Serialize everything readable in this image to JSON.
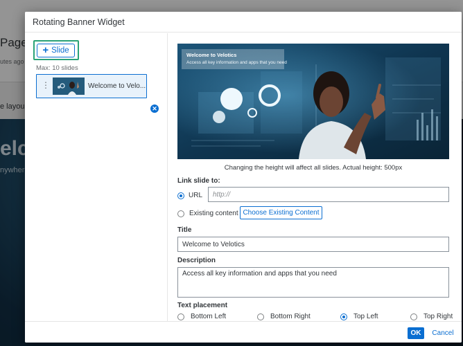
{
  "background": {
    "page_title": "Page",
    "time_fragment": "utes ago",
    "layout_fragment": "e layou",
    "welcome_fragment": "elco",
    "anywhere_fragment": "nywher"
  },
  "dialog": {
    "title": "Rotating Banner Widget",
    "add_slide_label": "Slide",
    "max_slides": "Max: 10 slides",
    "slides": [
      {
        "label": "Welcome to Velo..."
      }
    ],
    "preview": {
      "title": "Welcome to Velotics",
      "subtitle": "Access all key information and apps that you need"
    },
    "height_note": "Changing the height will affect all slides. Actual height: 500px",
    "link": {
      "label": "Link slide to:",
      "url_option": "URL",
      "url_placeholder": "http://",
      "url_value": "",
      "existing_option": "Existing content",
      "choose_button": "Choose Existing Content",
      "selected": "url"
    },
    "title_field": {
      "label": "Title",
      "value": "Welcome to Velotics"
    },
    "description_field": {
      "label": "Description",
      "value": "Access all key information and apps that you need"
    },
    "text_placement": {
      "label": "Text placement",
      "options": [
        "Bottom Left",
        "Bottom Right",
        "Top Left",
        "Top Right"
      ],
      "selected": "Top Left"
    },
    "footer": {
      "ok": "OK",
      "cancel": "Cancel"
    }
  },
  "colors": {
    "accent": "#0a6ed1",
    "highlight": "#2aa277"
  }
}
